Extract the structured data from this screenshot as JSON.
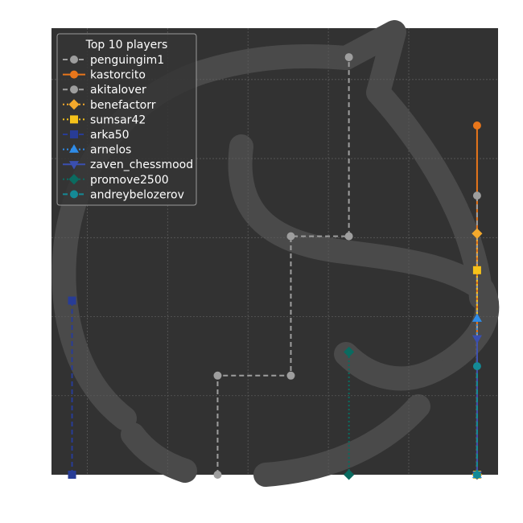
{
  "chart_data": {
    "type": "line",
    "title": "",
    "xlabel": "",
    "ylabel": "",
    "xlim": [
      0,
      1
    ],
    "ylim": [
      0,
      1
    ],
    "grid": true,
    "legend": {
      "title": "Top 10 players",
      "placement": "top-left"
    },
    "colors": {
      "figure_background": "#ffffff",
      "plot_background": "#323232",
      "watermark": "#4a4a4a",
      "grid": "#5a5a5a"
    },
    "series": [
      {
        "name": "penguingim1",
        "color": "#9e9e9e",
        "linestyle": "dashed",
        "marker": "circle",
        "points": [
          [
            0.372,
            0.0
          ],
          [
            0.372,
            0.222
          ],
          [
            0.536,
            0.222
          ],
          [
            0.536,
            0.534
          ],
          [
            0.666,
            0.534
          ],
          [
            0.666,
            0.935
          ]
        ]
      },
      {
        "name": "kastorcito",
        "color": "#e8761b",
        "linestyle": "solid",
        "marker": "circle",
        "points": [
          [
            0.953,
            0.0
          ],
          [
            0.953,
            0.782
          ]
        ]
      },
      {
        "name": "akitalover",
        "color": "#9e9e9e",
        "linestyle": "dashed",
        "marker": "circle",
        "points": [
          [
            0.953,
            0.0
          ],
          [
            0.953,
            0.625
          ]
        ]
      },
      {
        "name": "benefactorr",
        "color": "#f4a92c",
        "linestyle": "dotted",
        "marker": "diamond",
        "points": [
          [
            0.953,
            0.0
          ],
          [
            0.953,
            0.54
          ]
        ]
      },
      {
        "name": "sumsar42",
        "color": "#f6c31a",
        "linestyle": "dotted",
        "marker": "square",
        "points": [
          [
            0.953,
            0.0
          ],
          [
            0.953,
            0.458
          ]
        ]
      },
      {
        "name": "arka50",
        "color": "#283c96",
        "linestyle": "dashed",
        "marker": "square",
        "points": [
          [
            0.046,
            0.0
          ],
          [
            0.046,
            0.39
          ]
        ]
      },
      {
        "name": "arnelos",
        "color": "#2f8ce8",
        "linestyle": "dotted",
        "marker": "triangle-up",
        "points": [
          [
            0.953,
            0.0
          ],
          [
            0.953,
            0.35
          ]
        ]
      },
      {
        "name": "zaven_chessmood",
        "color": "#3a4fb0",
        "linestyle": "solid",
        "marker": "triangle-down",
        "points": [
          [
            0.953,
            0.0
          ],
          [
            0.953,
            0.305
          ]
        ]
      },
      {
        "name": "promove2500",
        "color": "#0b6b60",
        "linestyle": "dotted",
        "marker": "diamond",
        "points": [
          [
            0.666,
            0.0
          ],
          [
            0.666,
            0.275
          ]
        ]
      },
      {
        "name": "andreybelozerov",
        "color": "#148a96",
        "linestyle": "dashed",
        "marker": "circle",
        "points": [
          [
            0.953,
            0.0
          ],
          [
            0.953,
            0.243
          ]
        ]
      }
    ]
  }
}
